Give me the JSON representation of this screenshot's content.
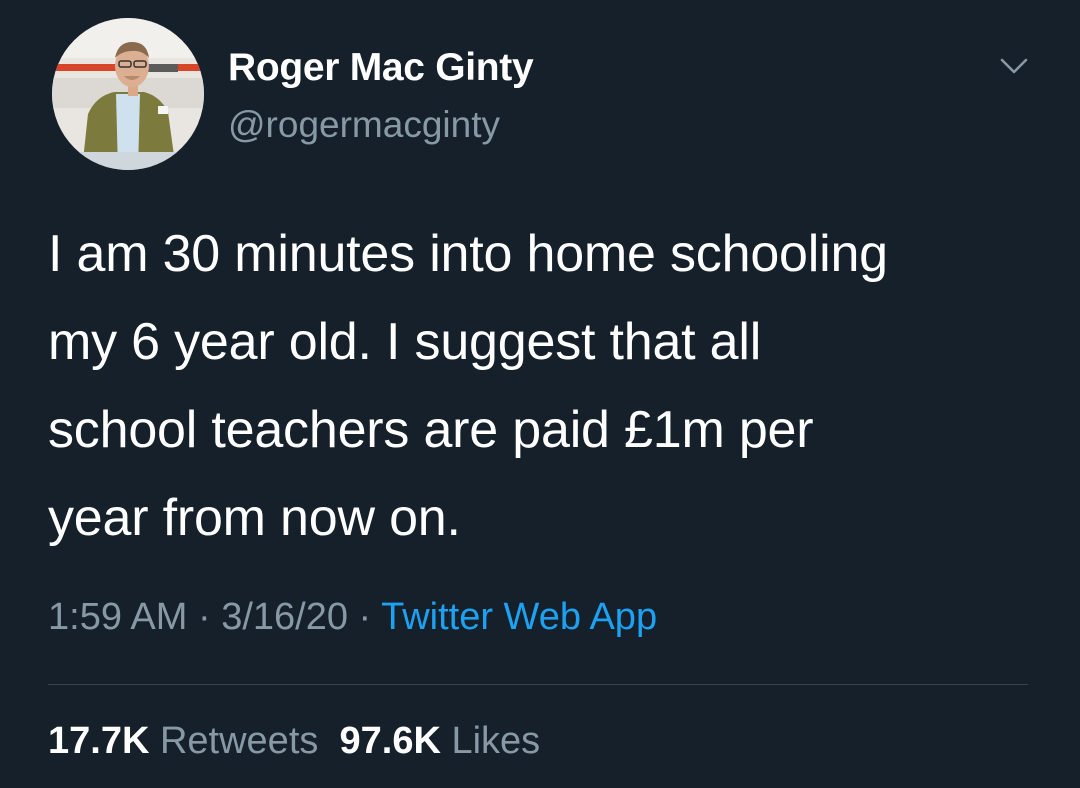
{
  "colors": {
    "background": "#15202b",
    "primary_text": "#ffffff",
    "secondary_text": "#8899a6",
    "link": "#1da1f2",
    "divider": "#38444d"
  },
  "author": {
    "display_name": "Roger Mac Ginty",
    "handle": "@rogermacginty",
    "avatar_icon": "profile-photo"
  },
  "menu": {
    "icon": "chevron-down-icon"
  },
  "tweet": {
    "lines": [
      "I am 30 minutes into home schooling",
      "my 6 year old. I suggest that all",
      "school teachers are paid £1m per",
      "year from now on."
    ]
  },
  "meta": {
    "time": "1:59 AM",
    "date": "3/16/20",
    "separator": " · ",
    "source": "Twitter Web App"
  },
  "stats": {
    "retweets_count": "17.7K",
    "retweets_label": "Retweets",
    "likes_count": "97.6K",
    "likes_label": "Likes"
  }
}
